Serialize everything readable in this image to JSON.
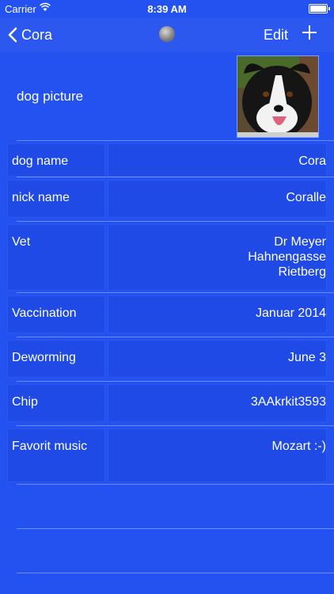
{
  "status": {
    "carrier": "Carrier",
    "time": "8:39 AM"
  },
  "nav": {
    "back_label": "Cora",
    "edit_label": "Edit"
  },
  "header": {
    "photo_label": "dog picture"
  },
  "fields": [
    {
      "label": "dog name",
      "value": "Cora"
    },
    {
      "label": "nick name",
      "value": "Coralle"
    },
    {
      "label": "Vet",
      "value": "Dr Meyer\nHahnengasse\nRietberg"
    },
    {
      "label": "Vaccination",
      "value": "Januar 2014"
    },
    {
      "label": "Deworming",
      "value": "June 3"
    },
    {
      "label": "Chip",
      "value": "3AAkrkit3593"
    },
    {
      "label": "Favorit music",
      "value": "Mozart    :-)"
    }
  ],
  "colors": {
    "background": "#2352f0",
    "cell": "#1f4ae6",
    "separator": "#6c8dff"
  }
}
